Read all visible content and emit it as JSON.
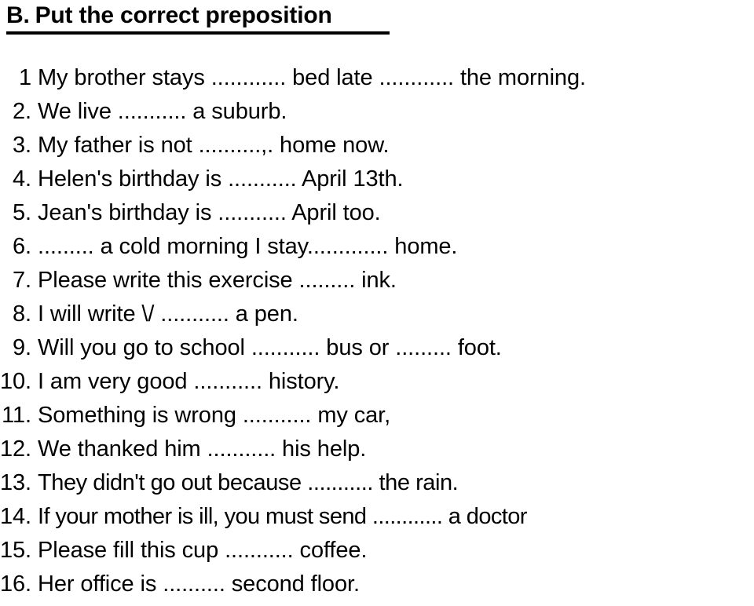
{
  "heading": {
    "label": "B.",
    "title": "Put the correct preposition"
  },
  "questions": [
    {
      "number": "1",
      "text": "My brother stays ............ bed late ............ the morning."
    },
    {
      "number": "2.",
      "text": "We live ........... a suburb."
    },
    {
      "number": "3.",
      "text": "My father is not ..........,. home now."
    },
    {
      "number": "4.",
      "text": "Helen's birthday is ........... April 13th."
    },
    {
      "number": "5.",
      "text": "Jean's birthday is ........... April too."
    },
    {
      "number": "6.",
      "text": "......... a cold morning I stay............. home."
    },
    {
      "number": "7.",
      "text": "Please write this exercise ......... ink."
    },
    {
      "number": "8.",
      "text": "I will write \\/ ........... a pen."
    },
    {
      "number": "9.",
      "text": "Will you go to school ........... bus or ......... foot."
    },
    {
      "number": "10.",
      "text": "I am very good ........... history."
    },
    {
      "number": "11.",
      "text": "Something is wrong ........... my car,"
    },
    {
      "number": "12.",
      "text": "We thanked him ........... his help."
    },
    {
      "number": "13.",
      "text": "They didn't go out because ........... the rain."
    },
    {
      "number": "14.",
      "text": "If your mother is ill, you must send ............ a doctor"
    },
    {
      "number": "15.",
      "text": "Please fill this cup ........... coffee."
    },
    {
      "number": "16.",
      "text": "Her office is .......... second floor."
    }
  ]
}
